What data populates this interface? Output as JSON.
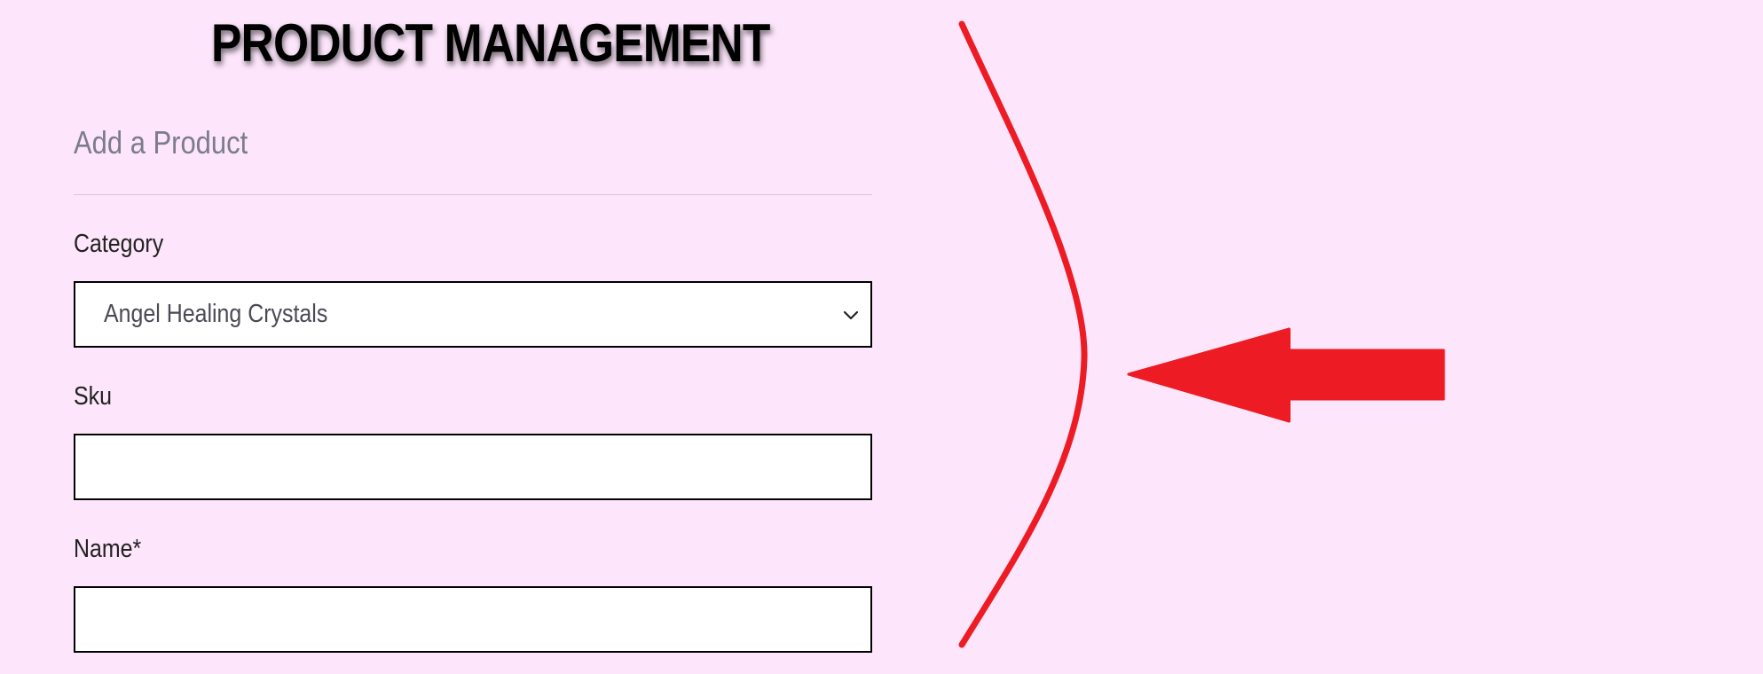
{
  "header": {
    "title": "PRODUCT MANAGEMENT"
  },
  "form": {
    "section_heading": "Add a Product",
    "category": {
      "label": "Category",
      "selected_value": "Angel Healing Crystals"
    },
    "sku": {
      "label": "Sku",
      "value": "",
      "placeholder": ""
    },
    "name": {
      "label": "Name*",
      "value": "",
      "placeholder": ""
    }
  },
  "icons": {
    "select_chevron": "chevron-down-icon",
    "annotation_arrow": "arrow-left-icon",
    "annotation_bracket": "curved-bracket-icon"
  },
  "colors": {
    "background": "#fde6fb",
    "annotation_red": "#ed1c24",
    "heading_muted": "#7c7c8c"
  }
}
